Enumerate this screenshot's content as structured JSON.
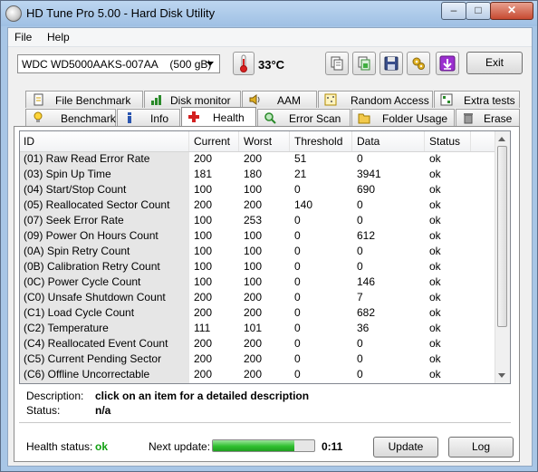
{
  "window": {
    "title": "HD Tune Pro 5.00 - Hard Disk Utility"
  },
  "menu": {
    "file": "File",
    "help": "Help"
  },
  "toolbar": {
    "drive": "WDC WD5000AAKS-007AA    (500 gB)",
    "temperature": "33°C",
    "exit_label": "Exit",
    "icons": [
      "copy-icon",
      "copy-screenshot-icon",
      "save-icon",
      "options-icon",
      "download-icon"
    ]
  },
  "tabs_row1": [
    "File Benchmark",
    "Disk monitor",
    "AAM",
    "Random Access",
    "Extra tests"
  ],
  "tabs_row2": [
    "Benchmark",
    "Info",
    "Health",
    "Error Scan",
    "Folder Usage",
    "Erase"
  ],
  "active_tab": "Health",
  "grid": {
    "headers": [
      "ID",
      "Current",
      "Worst",
      "Threshold",
      "Data",
      "Status"
    ],
    "rows": [
      [
        "(01) Raw Read Error Rate",
        "200",
        "200",
        "51",
        "0",
        "ok"
      ],
      [
        "(03) Spin Up Time",
        "181",
        "180",
        "21",
        "3941",
        "ok"
      ],
      [
        "(04) Start/Stop Count",
        "100",
        "100",
        "0",
        "690",
        "ok"
      ],
      [
        "(05) Reallocated Sector Count",
        "200",
        "200",
        "140",
        "0",
        "ok"
      ],
      [
        "(07) Seek Error Rate",
        "100",
        "253",
        "0",
        "0",
        "ok"
      ],
      [
        "(09) Power On Hours Count",
        "100",
        "100",
        "0",
        "612",
        "ok"
      ],
      [
        "(0A) Spin Retry Count",
        "100",
        "100",
        "0",
        "0",
        "ok"
      ],
      [
        "(0B) Calibration Retry Count",
        "100",
        "100",
        "0",
        "0",
        "ok"
      ],
      [
        "(0C) Power Cycle Count",
        "100",
        "100",
        "0",
        "146",
        "ok"
      ],
      [
        "(C0) Unsafe Shutdown Count",
        "200",
        "200",
        "0",
        "7",
        "ok"
      ],
      [
        "(C1) Load Cycle Count",
        "200",
        "200",
        "0",
        "682",
        "ok"
      ],
      [
        "(C2) Temperature",
        "111",
        "101",
        "0",
        "36",
        "ok"
      ],
      [
        "(C4) Reallocated Event Count",
        "200",
        "200",
        "0",
        "0",
        "ok"
      ],
      [
        "(C5) Current Pending Sector",
        "200",
        "200",
        "0",
        "0",
        "ok"
      ],
      [
        "(C6) Offline Uncorrectable",
        "200",
        "200",
        "0",
        "0",
        "ok"
      ]
    ]
  },
  "details": {
    "description_label": "Description:",
    "description_value": "click on an item for a detailed description",
    "status_label": "Status:",
    "status_value": "n/a"
  },
  "footer": {
    "health_label": "Health status:",
    "health_value": "ok",
    "next_update_label": "Next update:",
    "countdown": "0:11",
    "progress_fraction": 0.8,
    "update_label": "Update",
    "log_label": "Log"
  },
  "colors": {
    "health_ok": "#12a012",
    "progress": "#2fbf2f",
    "health_tab_icon": "#d32020"
  }
}
